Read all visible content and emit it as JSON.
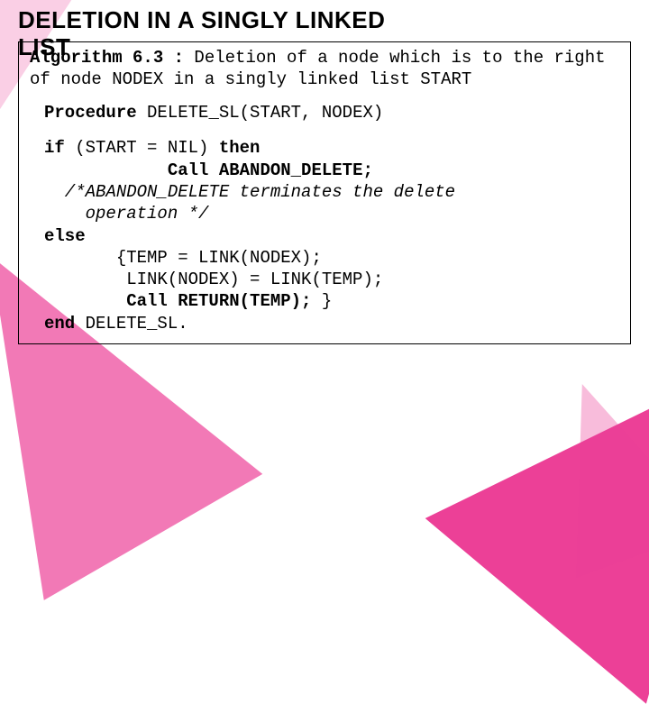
{
  "title_line1": "DELETION IN A SINGLY LINKED",
  "title_line2": "LIST",
  "intro_bold": "Algorithm 6.3 :",
  "intro_rest": " Deletion of a node which is to the right of  node NODEX in a singly linked list START",
  "procedure_label": "Procedure",
  "procedure_sig": "  DELETE_SL(START, NODEX)",
  "code": {
    "l1_kw1": "if",
    "l1_mid": " (START = NIL) ",
    "l1_kw2": "then",
    "l2a": "            Call",
    "l2b": " ABANDON_DELETE;",
    "l3": "  /*ABANDON_DELETE terminates the delete",
    "l4": "    operation */",
    "l5": "else",
    "l6": "       {TEMP = LINK(NODEX);",
    "l7": "        LINK(NODEX) = LINK(TEMP);",
    "l8a": "        Call",
    "l8b": " RETURN(TEMP); ",
    "l8c": "}",
    "l9a": "end",
    "l9b": " DELETE_SL."
  }
}
